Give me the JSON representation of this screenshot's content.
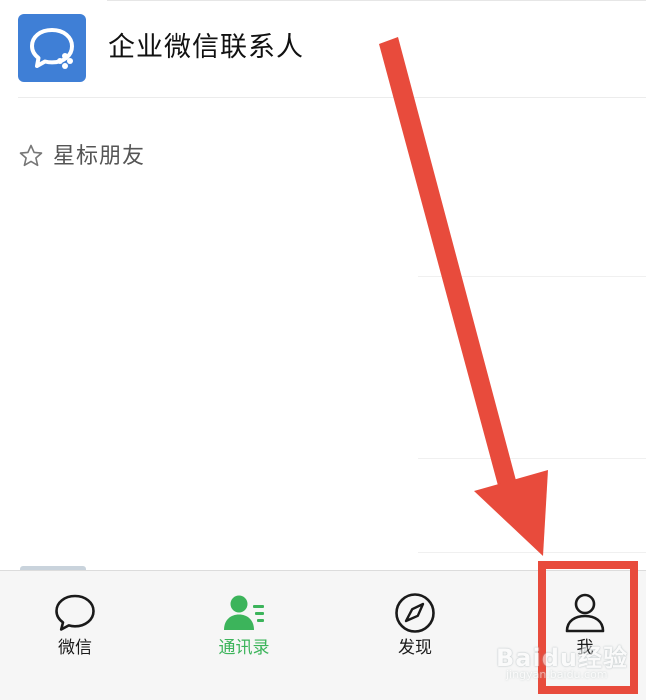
{
  "contacts": {
    "enterprise_label": "企业微信联系人",
    "starred_label": "星标朋友"
  },
  "tabbar": {
    "tabs": [
      {
        "label": "微信",
        "icon": "chat-bubble-icon",
        "active": false
      },
      {
        "label": "通讯录",
        "icon": "contacts-icon",
        "active": true
      },
      {
        "label": "发现",
        "icon": "compass-icon",
        "active": false
      },
      {
        "label": "我",
        "icon": "person-icon",
        "active": false
      }
    ]
  },
  "colors": {
    "active_tab": "#3cb45b",
    "enterprise_icon": "#3f7fd6",
    "annotation": "#e84b3c"
  },
  "watermark": {
    "main": "Baidu经验",
    "sub": "jingyan.baidu.com"
  }
}
